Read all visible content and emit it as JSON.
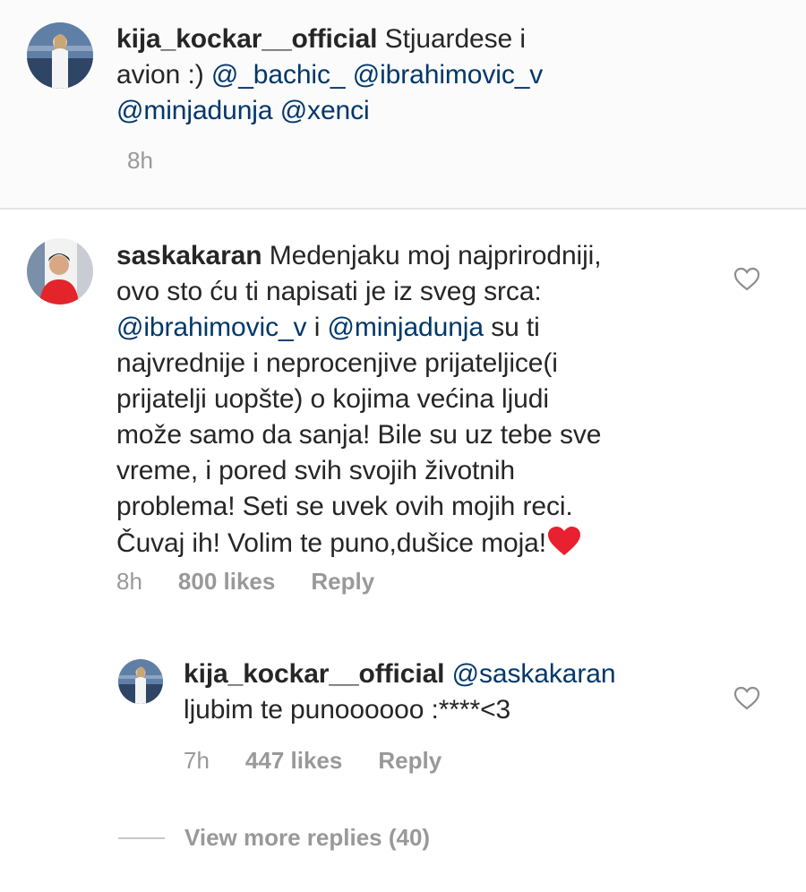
{
  "caption": {
    "username": "kija_kockar__official",
    "text_1": "Stjuardese i",
    "text_2": "avion :)",
    "mention_1": "@_bachic_",
    "mention_2": "@ibrahimovic_v",
    "mention_3": "@minjadunja",
    "mention_4": "@xenci",
    "time": "8h"
  },
  "comment": {
    "username": "saskakaran",
    "line_1": "Medenjaku moj najprirodniji,",
    "line_2": "ovo sto ću ti napisati je iz sveg srca:",
    "mention_1": "@ibrahimovic_v",
    "connector": " i ",
    "mention_2": "@minjadunja",
    "line_3_tail": " su ti",
    "line_4": "najvrednije i neprocenjive prijateljice(i",
    "line_5": "prijatelji uopšte) o kojima većina ljudi",
    "line_6": "može samo da sanja! Bile su uz tebe sve",
    "line_7": "vreme, i pored svih svojih životnih",
    "line_8": "problema! Seti se uvek ovih mojih reci.",
    "line_9": "Čuvaj ih! Volim te puno,dušice moja!",
    "emoji": "red-heart-emoji",
    "time": "8h",
    "likes": "800 likes",
    "reply_label": "Reply",
    "like_icon": "heart-outline-icon"
  },
  "reply": {
    "username": "kija_kockar__official",
    "mention": "@saskakaran",
    "text": "ljubim te punoooooo :****<3",
    "time": "7h",
    "likes": "447 likes",
    "reply_label": "Reply",
    "like_icon": "heart-outline-icon"
  },
  "view_more": {
    "label": "View more replies (40)"
  },
  "colors": {
    "mention": "#00376b",
    "meta": "#999999",
    "divider": "#e4e4e4",
    "emoji_heart": "#e8202f"
  }
}
